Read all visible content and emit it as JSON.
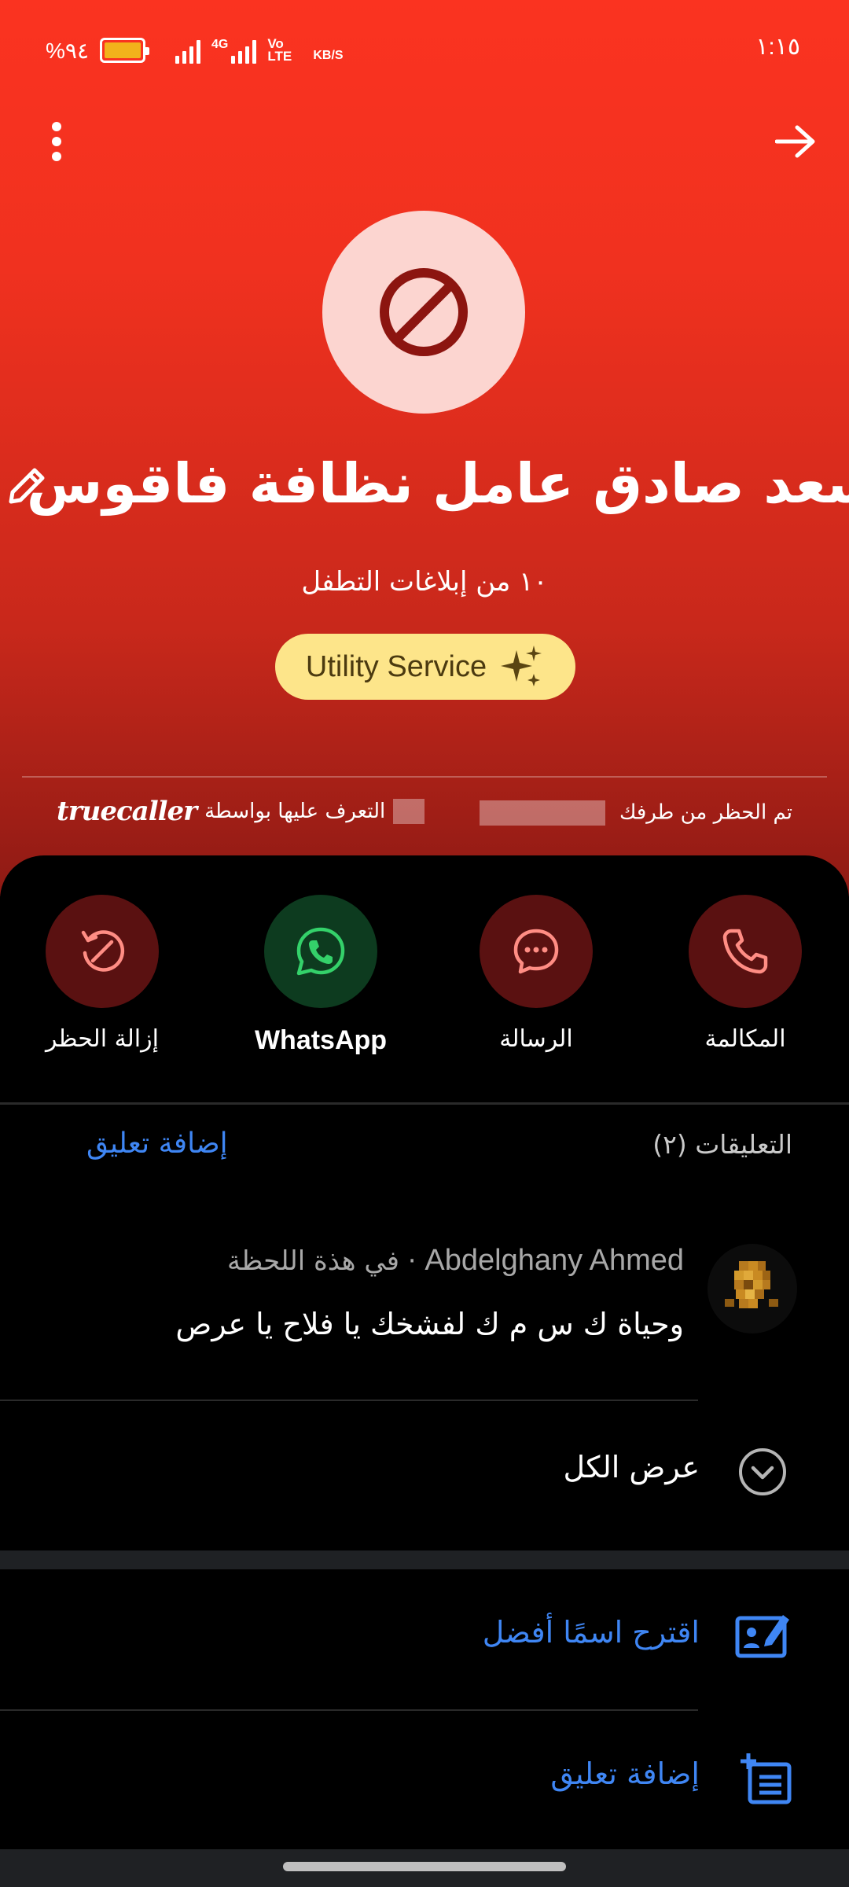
{
  "status_bar": {
    "battery_percent": "%٩٤",
    "battery_level": 0.94,
    "network_type": "4G",
    "volte_label": "Vo LTE",
    "data_speed_unit": "KB/S",
    "time": "١:١٥"
  },
  "header": {
    "menu_icon": "more-vert-icon",
    "back_icon": "arrow-forward-icon",
    "avatar_icon": "block-icon",
    "contact_name": "سعد صادق عامل نظافة فاقوس",
    "edit_icon": "pencil-icon",
    "spam_reports": "١٠ من إبلاغات التطفل",
    "tag_label": "Utility Service",
    "tag_icon": "sparkle-icon",
    "blocked_by_text": "تم الحظر من طرفك",
    "identified_by_text": "التعرف عليها بواسطة",
    "brand_logo": "truecaller",
    "colors": {
      "hero_top": "#fb3320",
      "hero_bottom": "#8e1a14",
      "tag_bg": "#fde58a"
    }
  },
  "actions": [
    {
      "label": "المكالمة",
      "icon": "phone-icon"
    },
    {
      "label": "الرسالة",
      "icon": "chat-bubble-icon"
    },
    {
      "label": "WhatsApp",
      "icon": "whatsapp-icon"
    },
    {
      "label": "إزالة الحظر",
      "icon": "unblock-icon"
    }
  ],
  "comments": {
    "title": "التعليقات (٢)",
    "add_link": "إضافة تعليق",
    "items": [
      {
        "author": "Abdelghany Ahmed",
        "time": "في هذة اللحظة",
        "separator": "·",
        "text": "وحياة ك س م ك لفشخك يا فلاح يا عرص"
      }
    ],
    "view_all": "عرض الكل",
    "view_all_icon": "chevron-down-circle-icon"
  },
  "bottom_actions": {
    "suggest_name": "اقترح اسمًا أفضل",
    "suggest_icon": "edit-card-icon",
    "add_comment": "إضافة تعليق",
    "add_comment_icon": "add-note-icon"
  },
  "accent_color": "#3f86f4"
}
